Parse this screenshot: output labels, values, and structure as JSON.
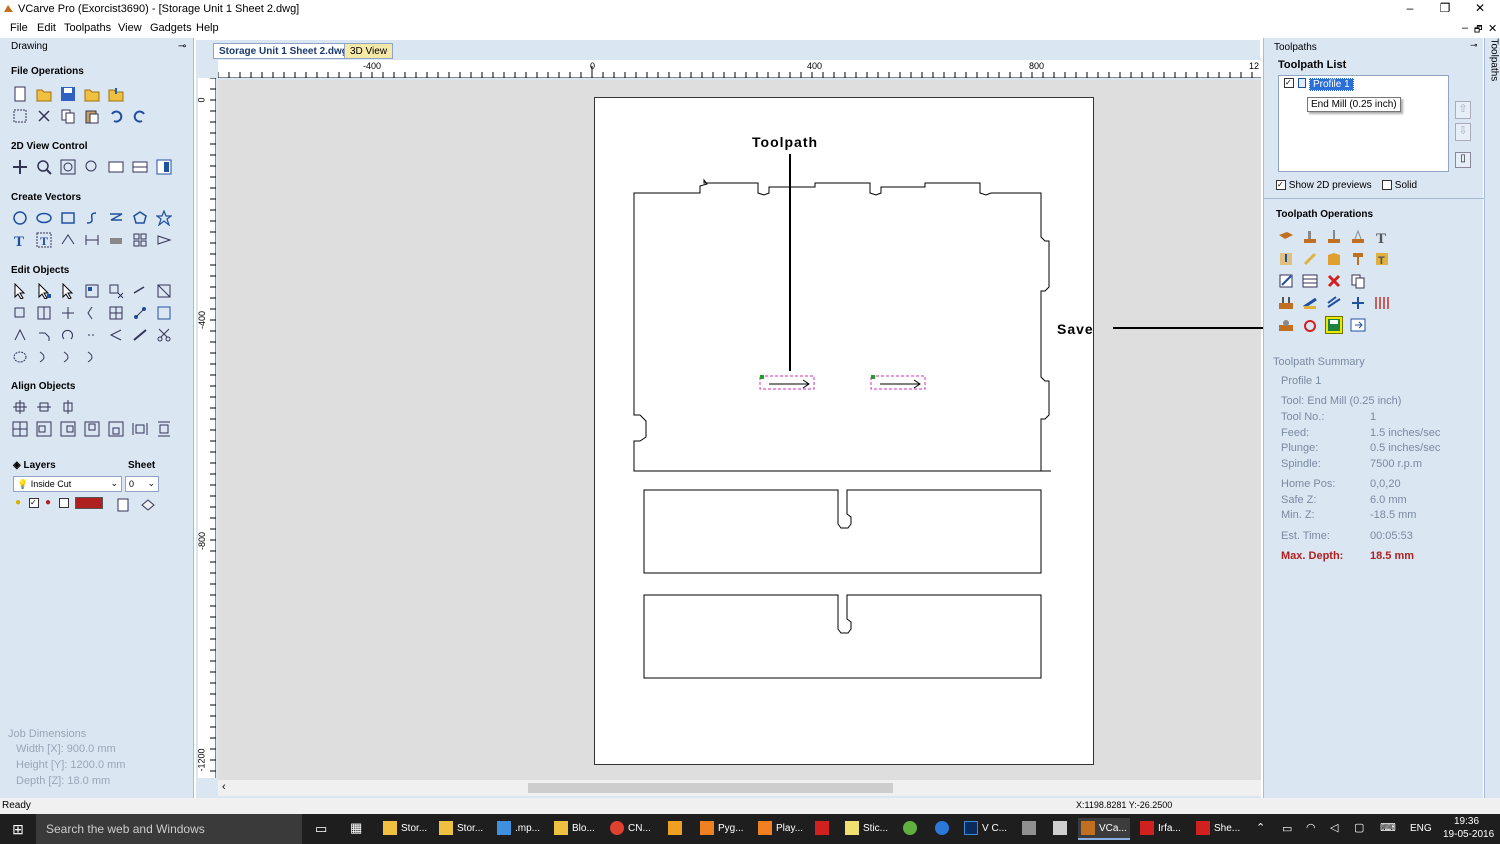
{
  "window": {
    "title": "VCarve Pro (Exorcist3690) - [Storage Unit 1 Sheet 2.dwg]",
    "controls": [
      "–",
      "❐",
      "✕"
    ]
  },
  "menu": [
    "File",
    "Edit",
    "Toolpaths",
    "View",
    "Gadgets",
    "Help"
  ],
  "mdi_controls": [
    "–",
    "🗗",
    "✕"
  ],
  "left_panel": {
    "header": "Drawing",
    "sections": {
      "file_ops": "File Operations",
      "view_2d": "2D View Control",
      "create_vectors": "Create Vectors",
      "edit_objects": "Edit Objects",
      "align_objects": "Align Objects"
    },
    "layers": {
      "label": "Layers",
      "sheet_label": "Sheet",
      "layer_value": "Inside Cut",
      "sheet_value": "0"
    },
    "job_dimensions": {
      "title": "Job Dimensions",
      "width": "Width  [X]: 900.0 mm",
      "height": "Height [Y]: 1200.0 mm",
      "depth": "Depth  [Z]: 18.0 mm"
    }
  },
  "tabs": [
    {
      "label": "Storage Unit 1 Sheet 2.dwg"
    },
    {
      "label": "3D View"
    }
  ],
  "ruler": {
    "h_labels": [
      "-400",
      "0",
      "400",
      "800",
      "12"
    ],
    "v_labels": [
      "0",
      "-400",
      "-800",
      "-1200"
    ]
  },
  "annotations": {
    "toolpath": "Toolpath",
    "save": "Save"
  },
  "right_panel": {
    "header": "Toolpaths",
    "side_tab": "Toolpaths",
    "list_title": "Toolpath List",
    "list_item": "Profile 1",
    "tooltip": "End Mill (0.25 inch)",
    "show_2d_previews": "Show 2D previews",
    "solid": "Solid",
    "ops_title": "Toolpath Operations",
    "summary": {
      "title": "Toolpath Summary",
      "name": "Profile 1",
      "tool": "Tool: End Mill (0.25 inch)",
      "rows": [
        {
          "k": "Tool No.:",
          "v": "1"
        },
        {
          "k": "Feed:",
          "v": "1.5 inches/sec"
        },
        {
          "k": "Plunge:",
          "v": "0.5 inches/sec"
        },
        {
          "k": "Spindle:",
          "v": "7500 r.p.m"
        },
        {
          "k": "Home Pos:",
          "v": "0,0,20"
        },
        {
          "k": "Safe Z:",
          "v": "6.0 mm"
        },
        {
          "k": "Min. Z:",
          "v": "-18.5 mm"
        },
        {
          "k": "Est. Time:",
          "v": "00:05:53"
        }
      ],
      "max_depth_label": "Max. Depth:",
      "max_depth_value": "18.5 mm"
    }
  },
  "status": {
    "ready": "Ready",
    "coords": "X:1198.8281 Y:-26.2500"
  },
  "taskbar": {
    "search": "Search the web and Windows",
    "apps": [
      "Stor...",
      "Stor...",
      ".mp...",
      "Blo...",
      "CN...",
      "Pyg...",
      "Play...",
      "Stic...",
      "V C...",
      "VCa...",
      "Irfa...",
      "She..."
    ],
    "lang": "ENG",
    "time": "19:36",
    "date": "19-05-2016"
  },
  "colors": {
    "panel": "#dbe6f3",
    "accent_red": "#b02020",
    "highlight": "#e8e800"
  }
}
